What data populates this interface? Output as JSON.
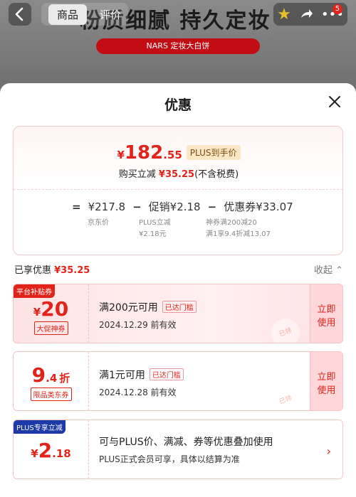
{
  "header": {
    "back_icon": "chevron-left-icon",
    "tabs": [
      "商品",
      "评价"
    ],
    "headline": "粉质细腻 持久定妆",
    "promo_pill": "NARS 定妆大白饼",
    "notification_count": "5"
  },
  "sheet": {
    "title": "优惠",
    "price": {
      "yen": "¥",
      "integer": "182",
      "decimal": ".55",
      "plus_tag": "PLUS到手价"
    },
    "reduce": {
      "prefix": "购买立减 ",
      "amount": "¥35.25",
      "suffix": "(不含税费)"
    },
    "formula": {
      "eq": "=",
      "jd_price": "¥217.8",
      "minus1": "−",
      "promo": "促销¥2.18",
      "minus2": "−",
      "coupon": "优惠券¥33.07",
      "jd_label": "京东价",
      "promo_sub1": "PLUS立减",
      "promo_sub2": "¥2.18元",
      "coupon_sub1": "神券满200减20",
      "coupon_sub2": "满1享9.4折减13.07"
    },
    "enjoyed": {
      "label": "已享优惠 ",
      "amount": "¥35.25"
    },
    "collapse": "收起 ⌃"
  },
  "coupons": [
    {
      "tag": "平台补贴券",
      "yen": "¥",
      "amount": "20",
      "sub_label": "大促神券",
      "title": "满200元可用",
      "status": "已达门槛",
      "expiry": "2024.12.29 前有效",
      "use_1": "立即",
      "use_2": "使用",
      "stamp": "已领"
    },
    {
      "amount_int": "9",
      "amount_dec": ".4",
      "unit": "折",
      "sub_label": "限品类东券",
      "title": "满1元可用",
      "status": "已达门槛",
      "expiry": "2024.12.28 前有效",
      "use_1": "立即",
      "use_2": "使用",
      "stamp": "已领"
    },
    {
      "tag": "PLUS专享立减",
      "yen": "¥",
      "amount_int": "2",
      "amount_dec": ".18",
      "title": "可与PLUS价、满减、券等优惠叠加使用",
      "desc": "PLUS正式会员可享，具体以结算为准",
      "chevron": "›"
    }
  ],
  "colors": {
    "accent": "#e2231a",
    "plus_blue": "#1e3aa8"
  }
}
